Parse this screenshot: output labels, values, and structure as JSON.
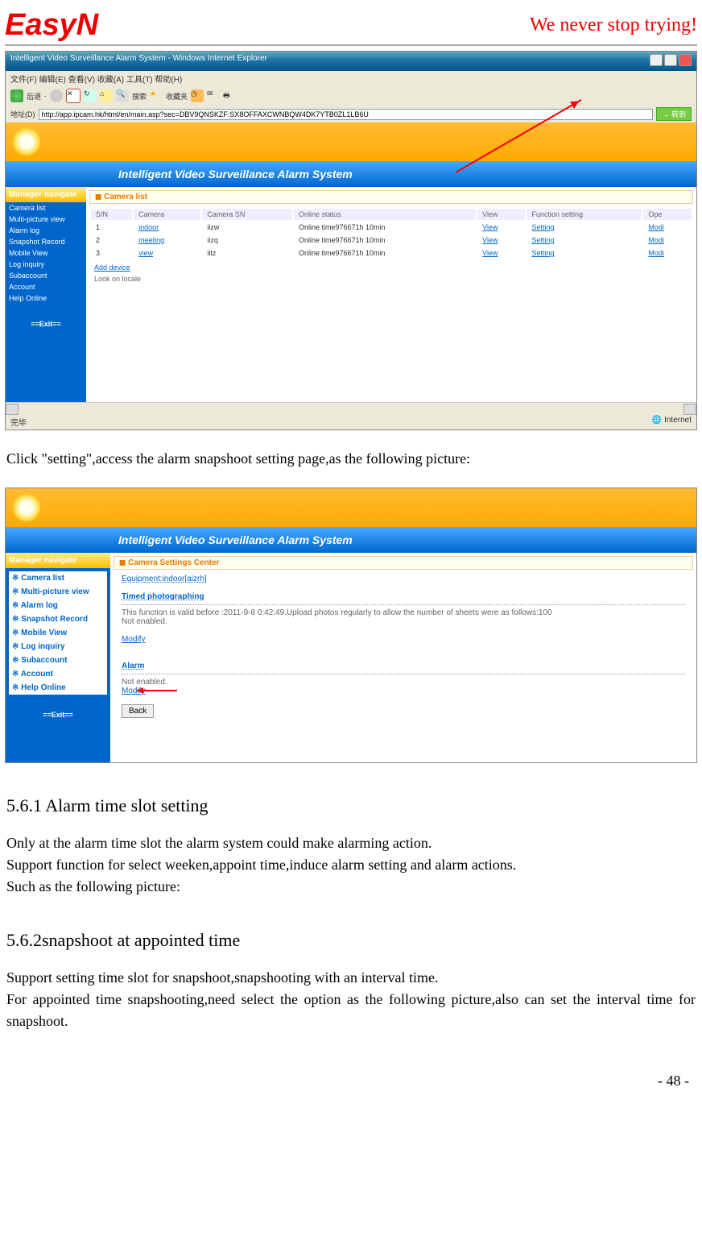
{
  "header": {
    "logo": "EasyN",
    "slogan": "We never stop trying!"
  },
  "shot1": {
    "title": "Intelligent Video Surveillance Alarm System - Windows Internet Explorer",
    "menu": "文件(F)  编辑(E)  查看(V)  收藏(A)  工具(T)  帮助(H)",
    "back": "后退",
    "search": "搜索",
    "fav": "收藏夹",
    "addr_label": "地址(D)",
    "url": "http://app.ipcam.hk/html/en/main.asp?sec=DBV9QNSKZF:SX8OFFAXCWNBQW4DK7YTB0ZL1LB6U",
    "go": "转到",
    "banner": "Intelligent  Video  Surveillance  Alarm  System",
    "nav_title": "Manager navigate",
    "nav": [
      "Camera list",
      "Multi-picture view",
      "Alarm log",
      "Snapshot Record",
      "Mobile View",
      "Log inquiry",
      "Subaccount",
      "Account",
      "Help Online"
    ],
    "exit": "==Exit==",
    "panel": "Camera list",
    "cols": [
      "S/N",
      "Camera",
      "Camera SN",
      "Online status",
      "View",
      "Function setting",
      "Ope"
    ],
    "rows": [
      {
        "sn": "1",
        "cam": "indoor",
        "csn": "iizw",
        "stat": "Online time976671h 10min",
        "view": "View",
        "set": "Setting",
        "op": "Modi"
      },
      {
        "sn": "2",
        "cam": "meeting",
        "csn": "iizq",
        "stat": "Online time976671h 10min",
        "view": "View",
        "set": "Setting",
        "op": "Modi"
      },
      {
        "sn": "3",
        "cam": "view",
        "csn": "iitz",
        "stat": "Online time976671h 10min",
        "view": "View",
        "set": "Setting",
        "op": "Modi"
      }
    ],
    "add": "Add device",
    "look": "Look on locale",
    "status_done": "完毕",
    "status_net": "Internet"
  },
  "para1": "Click \"setting\",access the alarm snapshoot setting page,as the following picture:",
  "shot2": {
    "banner": "Intelligent  Video  Surveillance  Alarm  System",
    "nav_title": "Manager navigate",
    "nav": [
      "Camera list",
      "Multi-picture view",
      "Alarm log",
      "Snapshot Record",
      "Mobile View",
      "Log inquiry",
      "Subaccount",
      "Account",
      "Help Online"
    ],
    "exit": "==Exit==",
    "panel": "Camera Settings Center",
    "equip": "Equipment:indoor[aizrh]",
    "timed_h": "Timed photographing",
    "timed_t": "This function is valid before :2011-9-8 0:42:49.Upload photos regularly to allow the number of sheets were as follows:100",
    "not_en": "Not enabled.",
    "modify": "Modify",
    "alarm": "Alarm",
    "back": "Back"
  },
  "h561": "5.6.1 Alarm time slot setting",
  "p561a": "Only at the alarm time slot the alarm system could make alarming action.",
  "p561b": "Support function for select weeken,appoint time,induce alarm setting and alarm actions.",
  "p561c": "Such as the following picture:",
  "h562": "5.6.2snapshoot at appointed time",
  "p562a": "Support setting time slot for snapshoot,snapshooting with an interval time.",
  "p562b": "For appointed time snapshooting,need select the option as the following picture,also can set the interval time for snapshoot.",
  "footer": "- 48 -"
}
